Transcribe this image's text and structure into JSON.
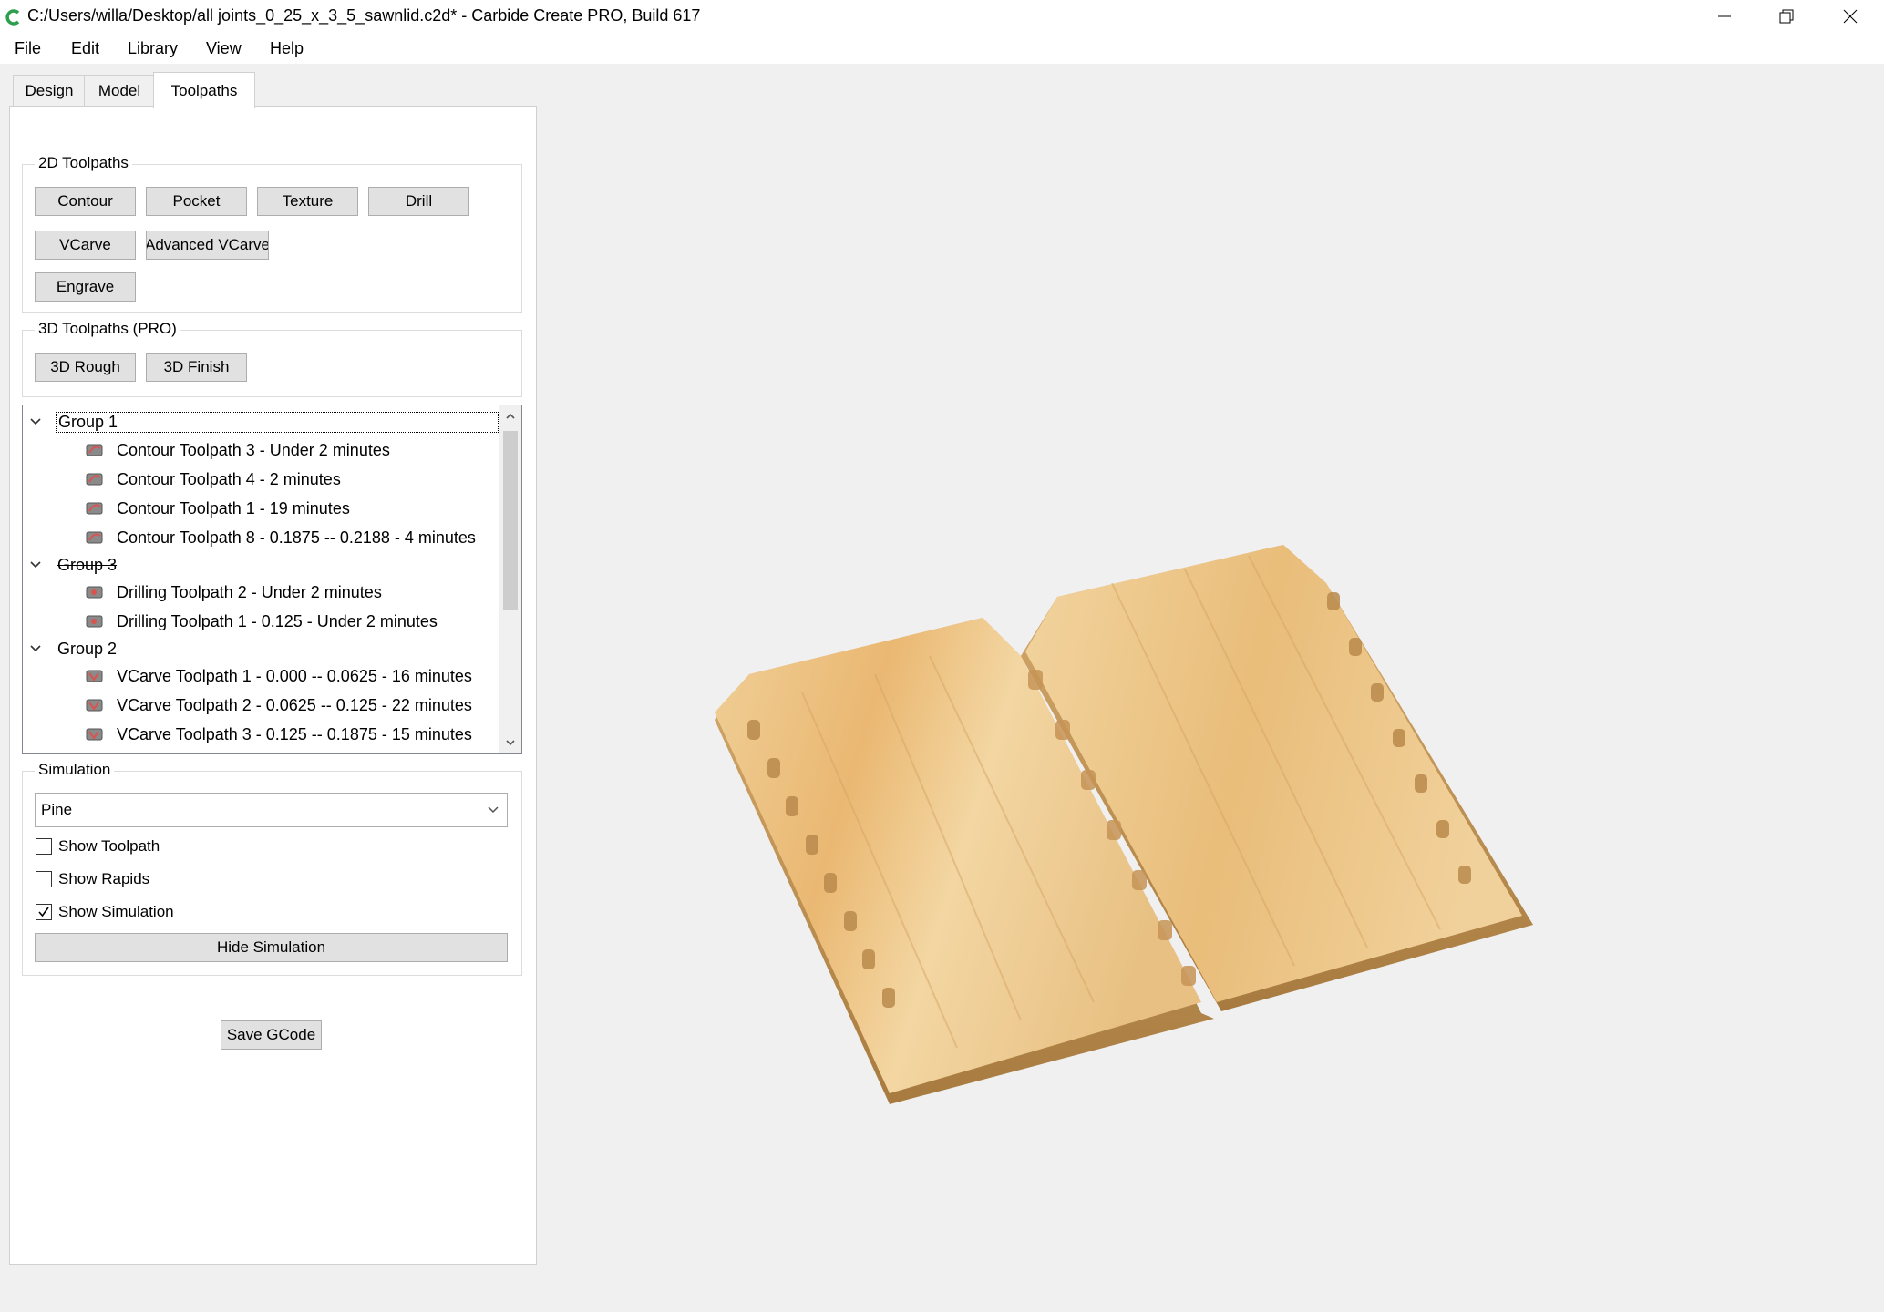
{
  "window": {
    "title": "C:/Users/willa/Desktop/all joints_0_25_x_3_5_sawnlid.c2d* - Carbide Create PRO, Build 617"
  },
  "menu": [
    "File",
    "Edit",
    "Library",
    "View",
    "Help"
  ],
  "tabs": [
    "Design",
    "Model",
    "Toolpaths"
  ],
  "active_tab": "Toolpaths",
  "toolpaths_2d": {
    "title": "2D Toolpaths",
    "buttons": [
      "Contour",
      "Pocket",
      "Texture",
      "Drill",
      "VCarve",
      "Advanced VCarve",
      "Engrave"
    ]
  },
  "toolpaths_3d": {
    "title": "3D Toolpaths (PRO)",
    "buttons": [
      "3D Rough",
      "3D Finish"
    ]
  },
  "tree": {
    "groups": [
      {
        "name": "Group 1",
        "items": [
          "Contour Toolpath 3 - Under 2 minutes",
          "Contour Toolpath 4 - 2 minutes",
          "Contour Toolpath 1 - 19 minutes",
          "Contour Toolpath 8 - 0.1875 -- 0.2188 - 4 minutes"
        ]
      },
      {
        "name": "Group 3",
        "items": [
          "Drilling Toolpath 2 - Under 2 minutes",
          "Drilling Toolpath 1 - 0.125 - Under 2 minutes"
        ]
      },
      {
        "name": "Group 2",
        "items": [
          "VCarve Toolpath 1 - 0.000 -- 0.0625 - 16 minutes",
          "VCarve Toolpath 2 - 0.0625 -- 0.125 - 22 minutes",
          "VCarve Toolpath 3 - 0.125 -- 0.1875 - 15 minutes"
        ]
      }
    ]
  },
  "simulation": {
    "title": "Simulation",
    "material": "Pine",
    "show_toolpath": {
      "label": "Show Toolpath",
      "checked": false
    },
    "show_rapids": {
      "label": "Show Rapids",
      "checked": false
    },
    "show_simulation": {
      "label": "Show Simulation",
      "checked": true
    },
    "hide_button": "Hide Simulation"
  },
  "save_gcode": "Save GCode",
  "colors": {
    "accent": "#0078d7",
    "wood_light": "#f3d29a",
    "wood_dark": "#b98a4c"
  }
}
